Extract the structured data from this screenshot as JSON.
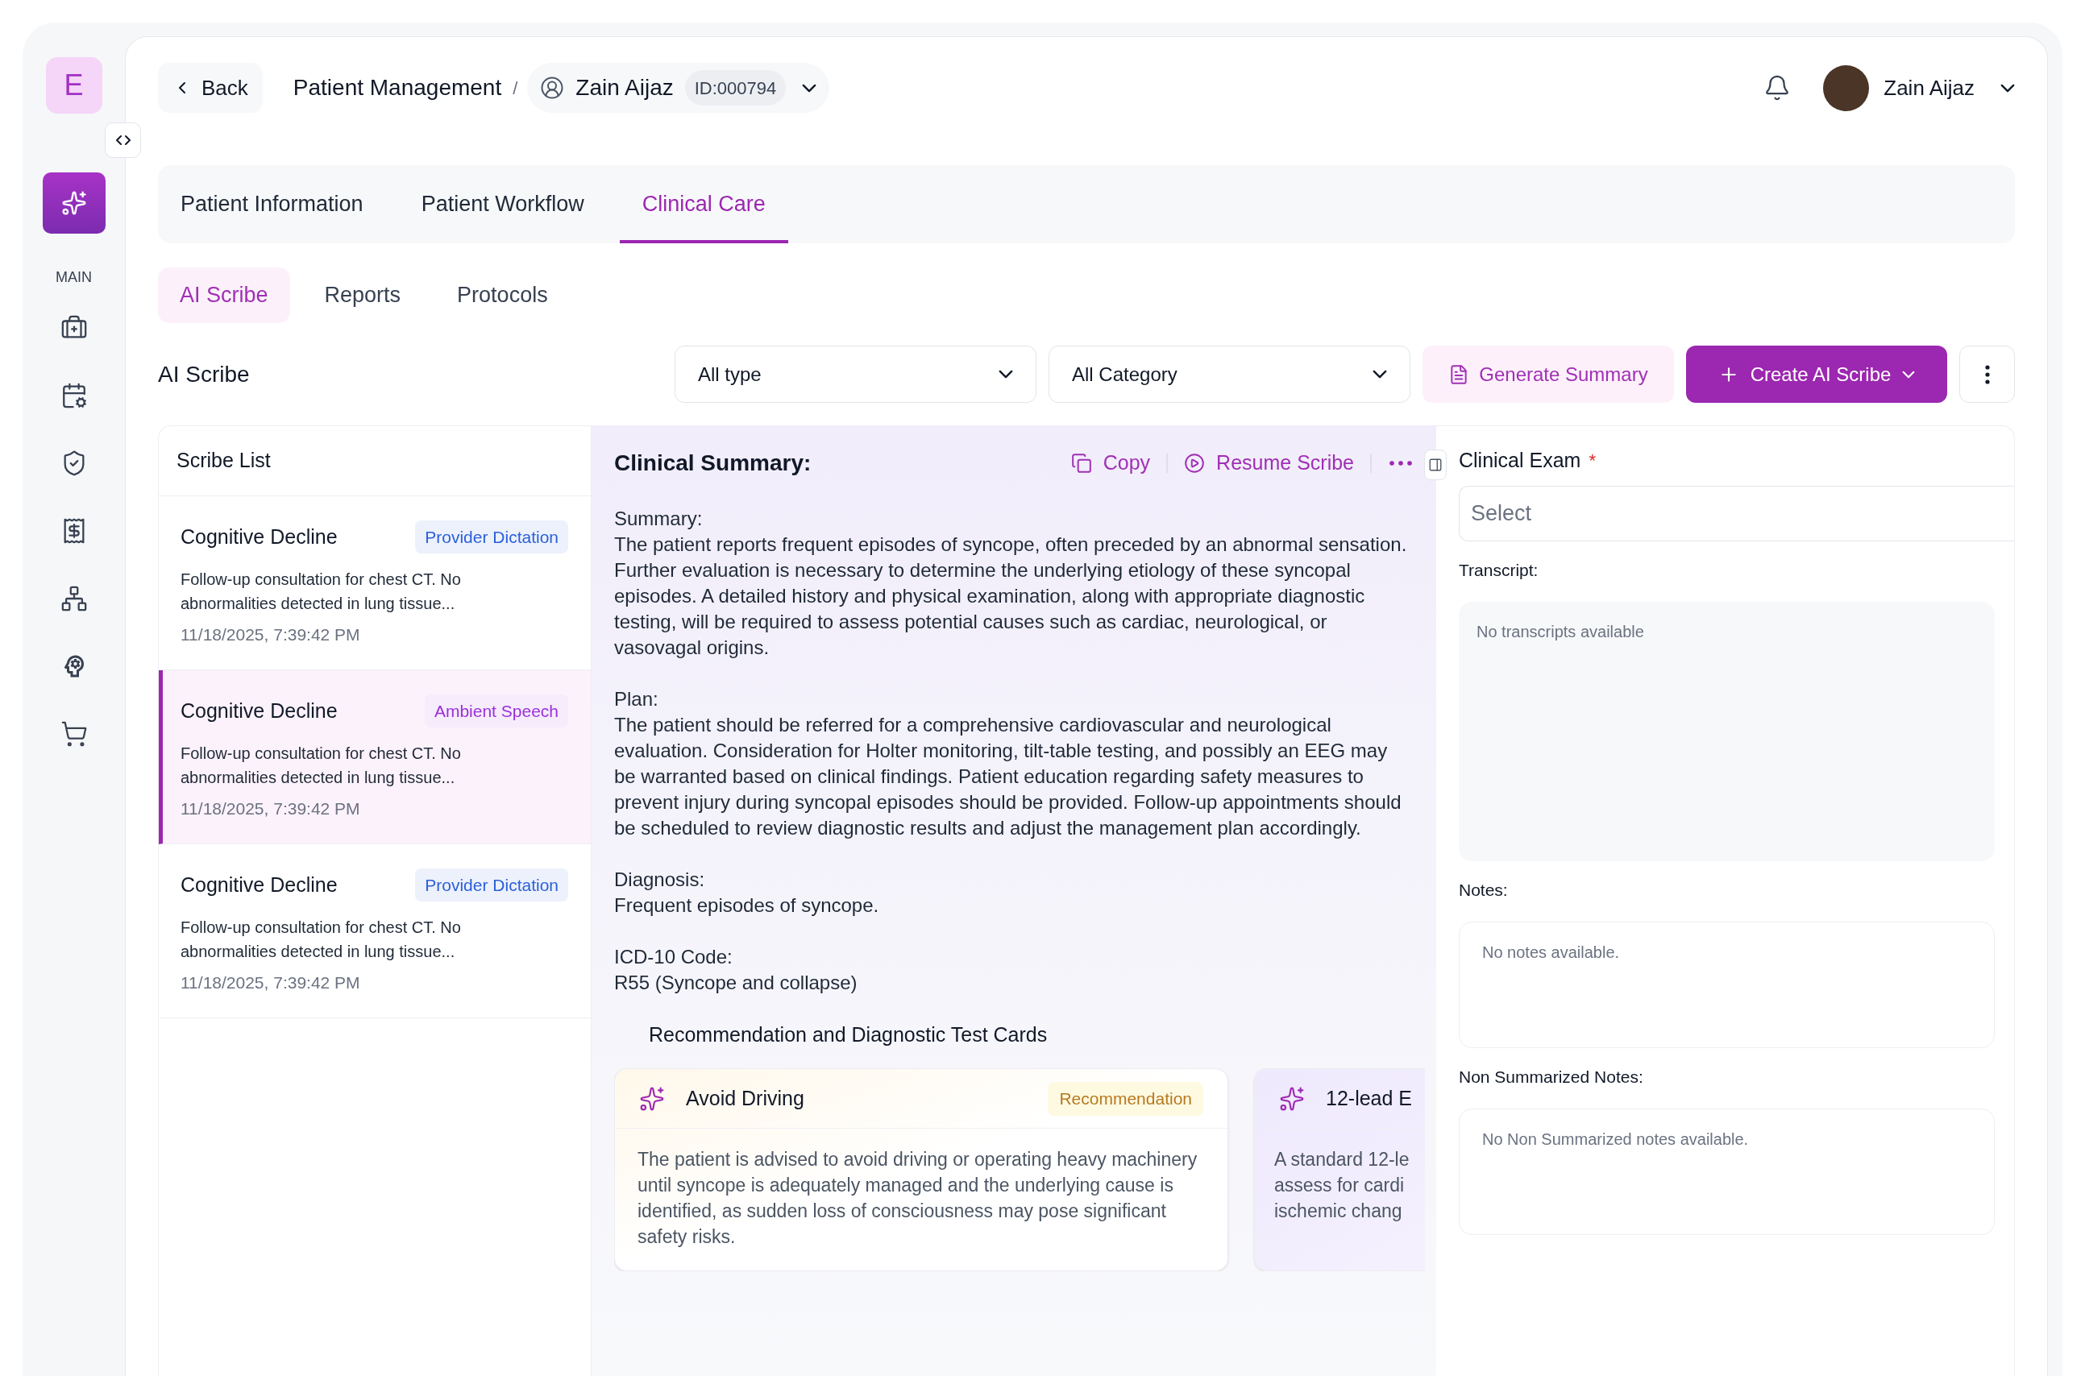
{
  "sidebar": {
    "logo": "E",
    "feature_button": {
      "selected": true
    },
    "section_label": "MAIN",
    "items": [
      {
        "selected": false
      },
      {
        "selected": false
      },
      {
        "selected": false
      },
      {
        "selected": false
      },
      {
        "selected": false
      },
      {
        "selected": false
      },
      {
        "selected": false
      }
    ]
  },
  "header": {
    "back_label": "Back",
    "breadcrumb": "Patient Management",
    "separator": "/",
    "patient": {
      "name": "Zain Aijaz",
      "id": "ID:000794"
    },
    "user": {
      "name": "Zain Aijaz"
    }
  },
  "tabs": [
    {
      "label": "Patient Information",
      "selected": false
    },
    {
      "label": "Patient Workflow",
      "selected": false
    },
    {
      "label": "Clinical Care",
      "selected": true
    }
  ],
  "sub_tabs": [
    {
      "label": "AI Scribe",
      "selected": true
    },
    {
      "label": "Reports",
      "selected": false
    },
    {
      "label": "Protocols",
      "selected": false
    }
  ],
  "toolbar": {
    "title": "AI Scribe",
    "filters": [
      {
        "value": "All type"
      },
      {
        "value": "All Category"
      }
    ],
    "generate_button": "Generate Summary",
    "create_button": "Create AI Scribe"
  },
  "scribe_list": {
    "title": "Scribe List",
    "items": [
      {
        "title": "Cognitive Decline",
        "tag": {
          "label": "Provider Dictation",
          "color": "#2b5fd9"
        },
        "description": "Follow-up consultation for chest CT. No abnormalities detected in lung tissue...",
        "date": "11/18/2025, 7:39:42 PM",
        "selected": false
      },
      {
        "title": "Cognitive Decline",
        "tag": {
          "label": "Ambient Speech",
          "color": "#9b30d9"
        },
        "description": "Follow-up consultation for chest CT. No abnormalities detected in lung tissue...",
        "date": "11/18/2025, 7:39:42 PM",
        "selected": true
      },
      {
        "title": "Cognitive Decline",
        "tag": {
          "label": "Provider Dictation",
          "color": "#2b5fd9"
        },
        "description": "Follow-up consultation for chest CT. No abnormalities detected in lung tissue...",
        "date": "11/18/2025, 7:39:42 PM",
        "selected": false
      }
    ]
  },
  "summary": {
    "title": "Clinical Summary:",
    "actions": [
      {
        "kind": "copy",
        "label": "Copy"
      },
      {
        "kind": "resume",
        "label": "Resume Scribe"
      }
    ],
    "sections": [
      {
        "label": "Summary:",
        "text": "The patient reports frequent episodes of syncope, often preceded by an abnormal sensation. Further evaluation is necessary to determine the underlying etiology of these syncopal episodes. A detailed history and physical examination, along with appropriate diagnostic testing, will be required to assess potential causes such as cardiac, neurological, or vasovagal origins."
      },
      {
        "label": "Plan:",
        "text": "The patient should be referred for a comprehensive cardiovascular and neurological evaluation. Consideration for Holter monitoring, tilt-table testing, and possibly an EEG may be warranted based on clinical findings. Patient education regarding safety measures to prevent injury during syncopal episodes should be provided. Follow-up appointments should be scheduled to review diagnostic results and adjust the management plan accordingly."
      },
      {
        "label": "Diagnosis:",
        "text": "Frequent episodes of syncope."
      },
      {
        "label": "ICD-10 Code:",
        "text": "R55 (Syncope and collapse)"
      }
    ],
    "cards_title": "Recommendation and Diagnostic Test Cards",
    "cards": [
      {
        "kind": "recommendation",
        "title": "Avoid Driving",
        "tag": "Recommendation",
        "description": "The patient is advised to avoid driving or operating heavy machinery until syncope is adequately managed and the underlying cause is identified, as sudden loss of consciousness may pose significant safety risks."
      },
      {
        "kind": "diagnostic",
        "title": "12-lead E",
        "visible_lines": [
          "A standard 12-le",
          "assess for cardi",
          "ischemic chang"
        ]
      }
    ]
  },
  "exam_panel": {
    "clinical_exam": {
      "label": "Clinical Exam",
      "required_mark": "*",
      "placeholder": "Select"
    },
    "fields": [
      {
        "kind": "transcript",
        "label": "Transcript:",
        "placeholder": "No transcripts available"
      },
      {
        "kind": "notes",
        "label": "Notes:",
        "placeholder": "No notes available."
      },
      {
        "kind": "notes",
        "label": "Non Summarized Notes:",
        "placeholder": "No Non Summarized notes available."
      }
    ]
  }
}
